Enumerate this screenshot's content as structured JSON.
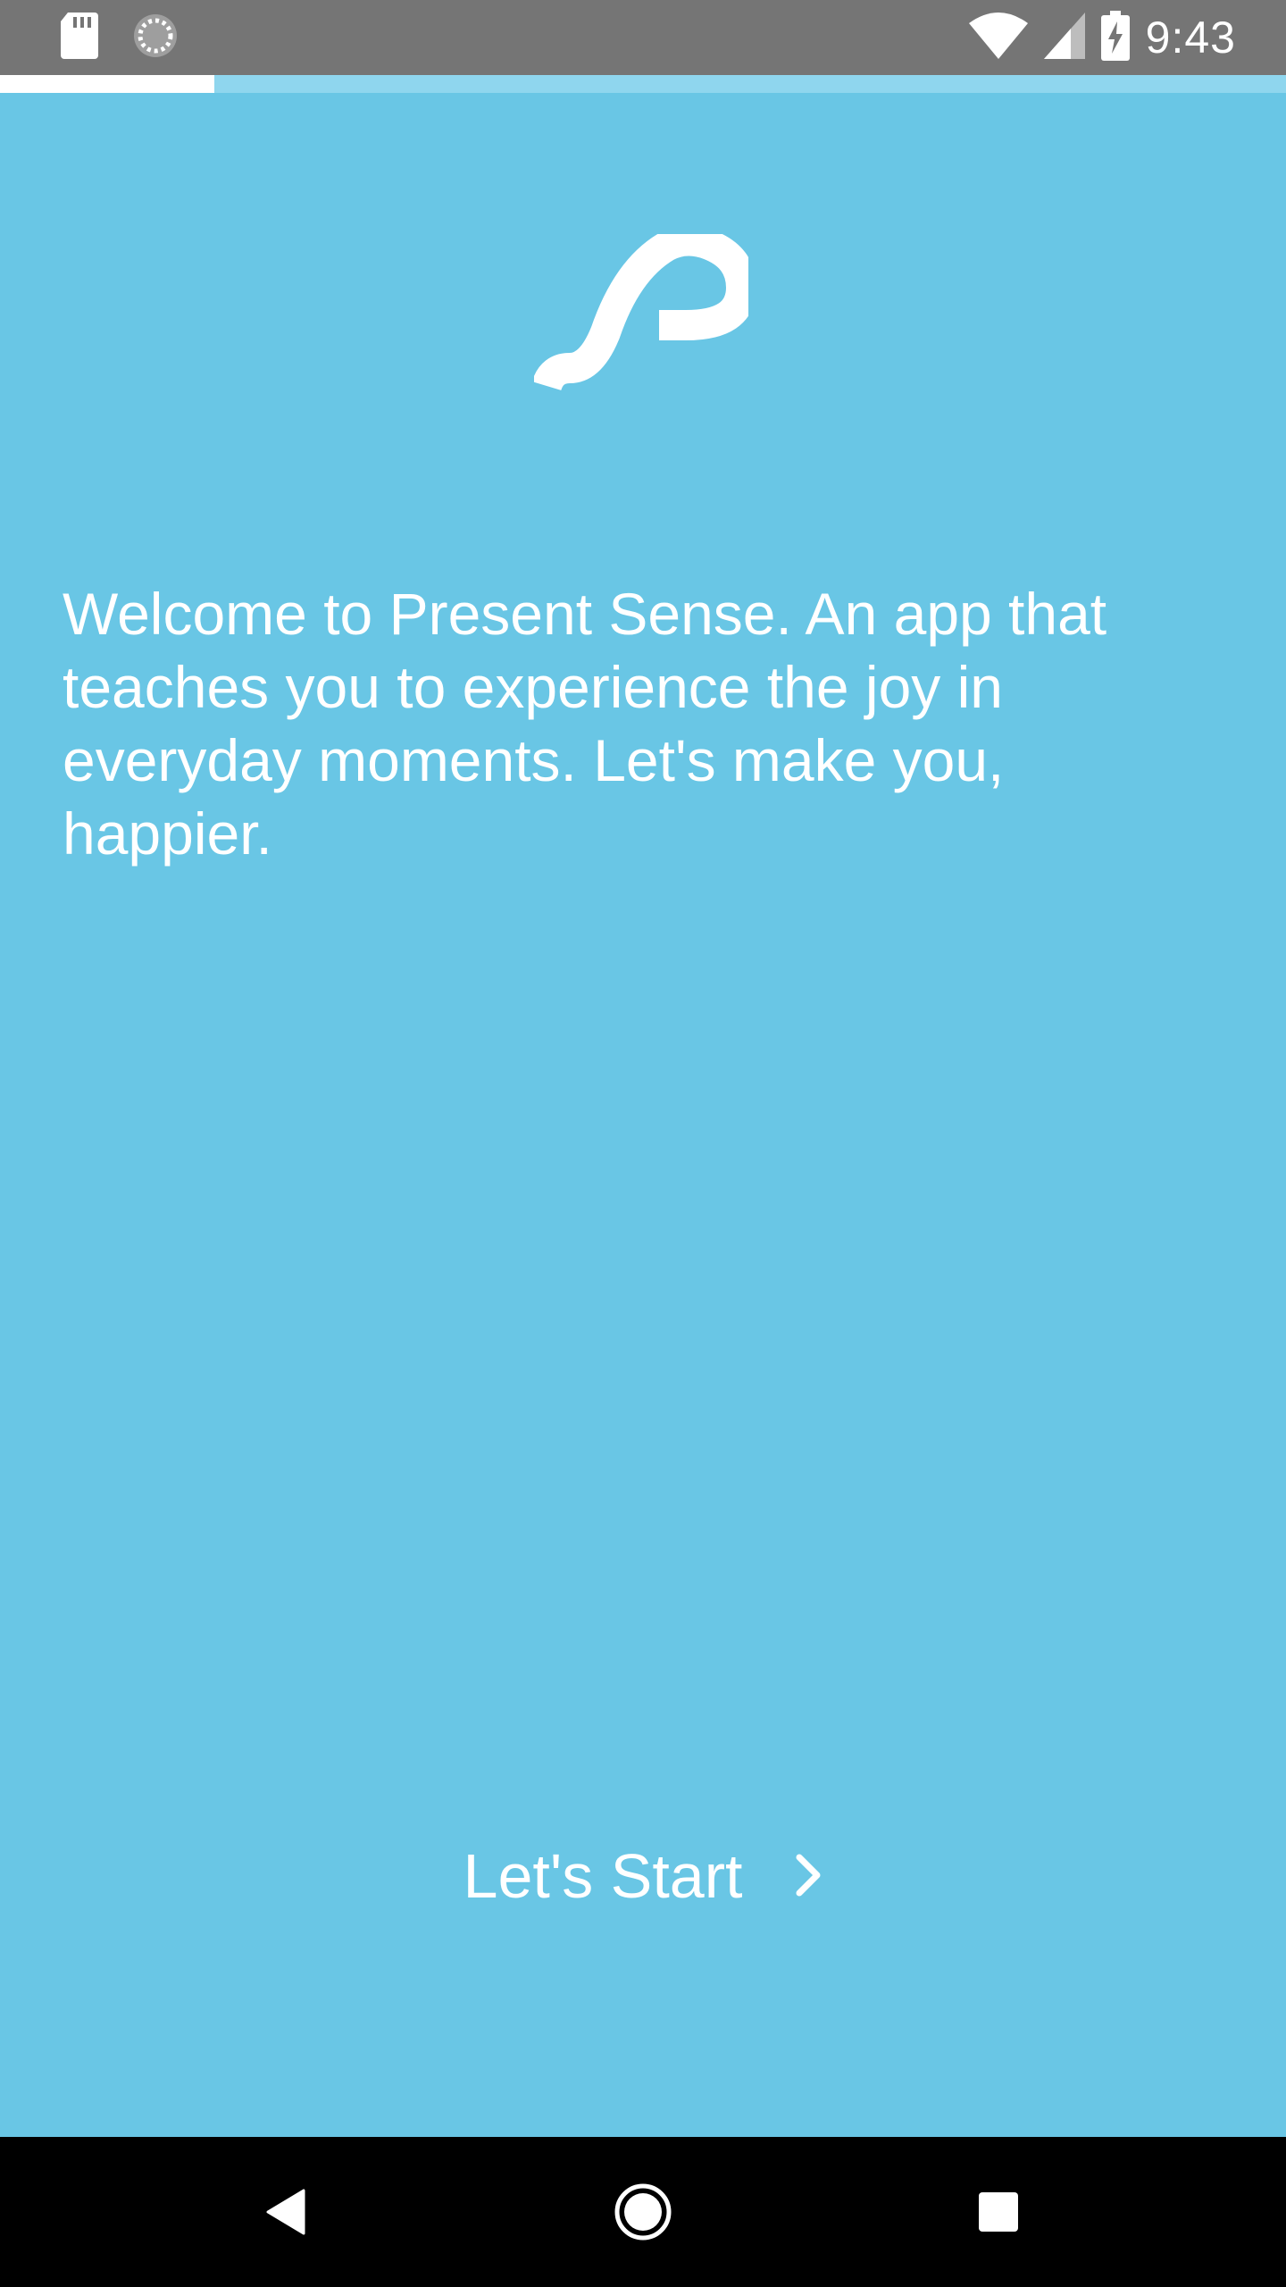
{
  "status_bar": {
    "time": "9:43",
    "icons": [
      "sd-card-icon",
      "sync-icon",
      "wifi-icon",
      "signal-icon",
      "battery-charging-icon"
    ]
  },
  "progress": {
    "fraction": 0.167
  },
  "logo": {
    "icon": "present-sense-logo-icon"
  },
  "welcome": {
    "text": "Welcome to Present Sense. An app that teaches you to experience the joy in everyday moments. Let's make you, happier."
  },
  "start_button": {
    "label": "Let's Start",
    "icon": "chevron-right-icon"
  },
  "nav_bar": {
    "icons": [
      "back-icon",
      "home-icon",
      "recents-icon"
    ]
  },
  "colors": {
    "background": "#69c6e5",
    "status_bar": "#757575",
    "progress_track": "#8fd6ee",
    "progress_fill": "#ffffff",
    "text": "#ffffff",
    "nav_bar": "#000000"
  }
}
